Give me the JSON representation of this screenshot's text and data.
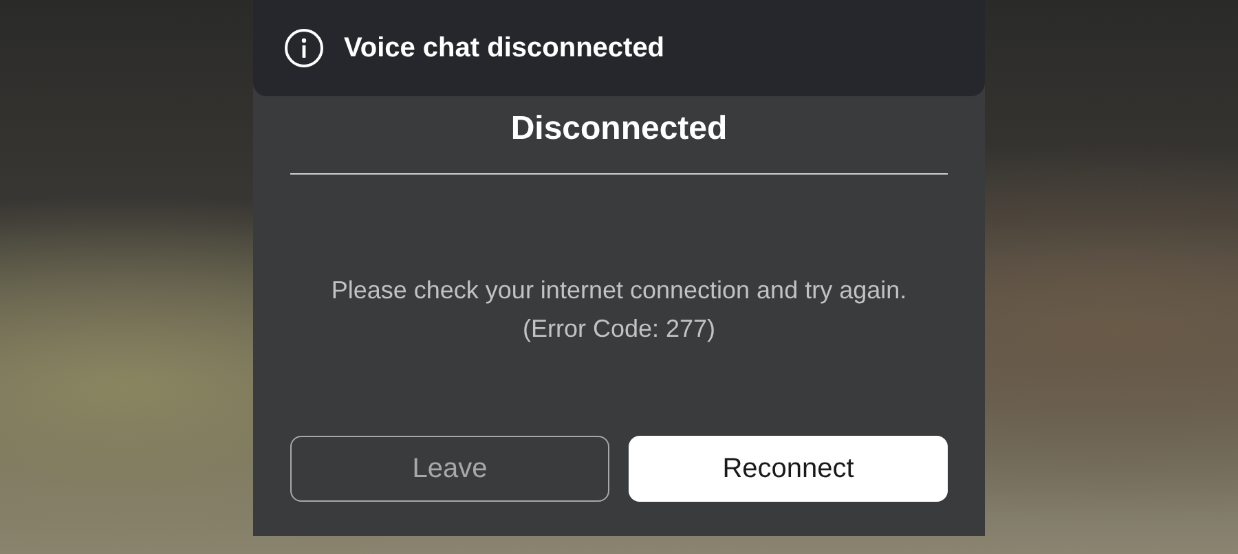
{
  "toast": {
    "text": "Voice chat disconnected"
  },
  "dialog": {
    "title": "Disconnected",
    "message": "Please check your internet connection and try again.",
    "error_code": "(Error Code: 277)"
  },
  "buttons": [
    {
      "label": "Leave",
      "kind": "secondary"
    },
    {
      "label": "Reconnect",
      "kind": "primary"
    }
  ]
}
